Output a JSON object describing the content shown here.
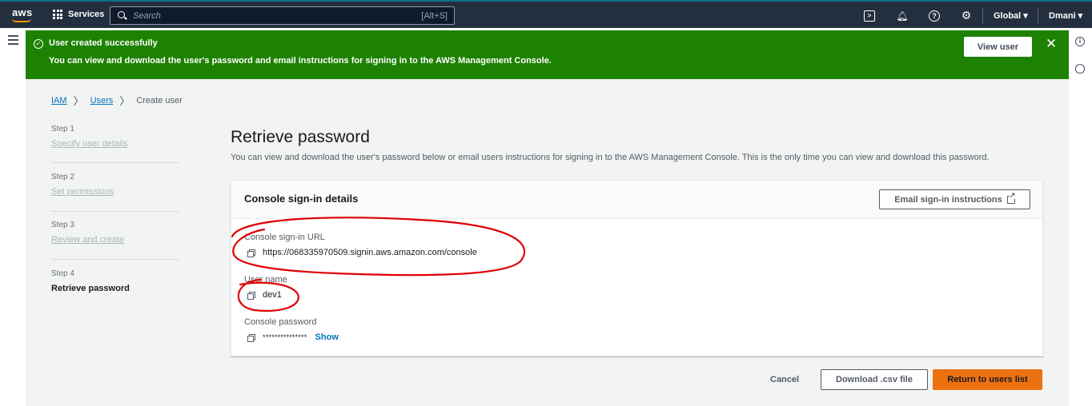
{
  "topnav": {
    "logo": "aws",
    "services_label": "Services",
    "search_placeholder": "Search",
    "search_shortcut": "[Alt+S]",
    "region": "Global ▾",
    "account": "Dmani ▾",
    "icons": [
      "grid-icon",
      "search-icon",
      "cloudshell-icon",
      "bell-icon",
      "help-icon",
      "gear-icon"
    ]
  },
  "flash": {
    "type": "success",
    "color": "#1d8102",
    "title": "User created successfully",
    "message": "You can view and download the user's password and email instructions for signing in to the AWS Management Console.",
    "view_user_label": "View user",
    "close_glyph": "✕"
  },
  "breadcrumb": {
    "items": [
      {
        "label": "IAM"
      },
      {
        "label": "Users"
      },
      {
        "label": "Create user"
      }
    ],
    "separator": "〉"
  },
  "steps": [
    {
      "number": "Step 1",
      "label": "Specify user details"
    },
    {
      "number": "Step 2",
      "label": "Set permissions"
    },
    {
      "number": "Step 3",
      "label": "Review and create"
    },
    {
      "number": "Step 4",
      "label": "Retrieve password"
    }
  ],
  "main": {
    "title": "Retrieve password",
    "description": "You can view and download the user's password below or email users instructions for signing in to the AWS Management Console. This is the only time you can view and download this password."
  },
  "panel": {
    "title": "Console sign-in details",
    "email_button": "Email sign-in instructions",
    "fields": {
      "url_label": "Console sign-in URL",
      "url_value": "https://068335970509.signin.aws.amazon.com/console",
      "username_label": "User name",
      "username_value": "dev1",
      "password_label": "Console password",
      "password_value": "***************",
      "show_label": "Show"
    }
  },
  "footer": {
    "cancel": "Cancel",
    "download": "Download .csv file",
    "return": "Return to users list"
  },
  "colors": {
    "nav_bg": "#232f3e",
    "primary_button": "#ec7211",
    "link": "#0073bb",
    "annotation": "#e00000"
  }
}
